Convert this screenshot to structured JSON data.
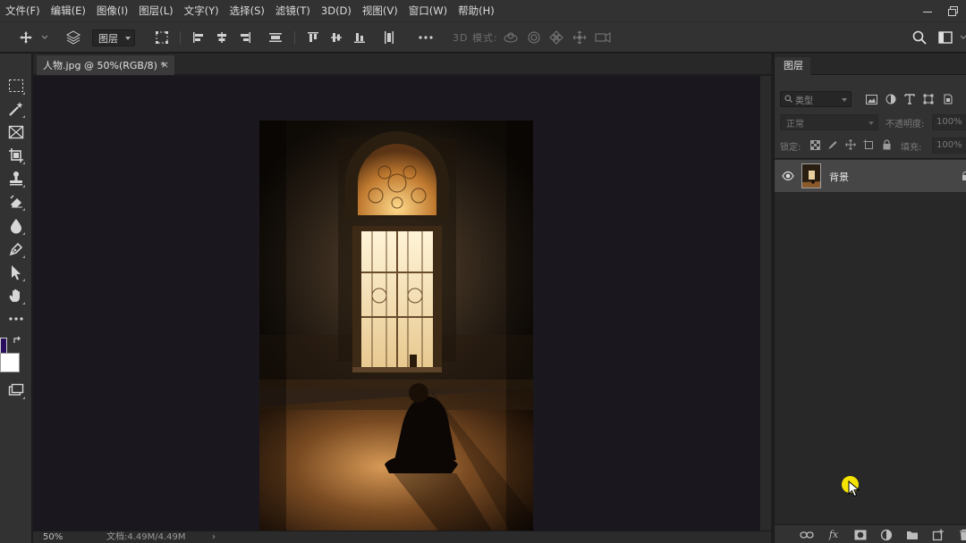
{
  "menu": {
    "items": [
      "文件(F)",
      "编辑(E)",
      "图像(I)",
      "图层(L)",
      "文字(Y)",
      "选择(S)",
      "滤镜(T)",
      "3D(D)",
      "视图(V)",
      "窗口(W)",
      "帮助(H)"
    ]
  },
  "options": {
    "auto_select_target": "图层",
    "mode_3d_label": "3D 模式:"
  },
  "document": {
    "tab_title": "人物.jpg @ 50%(RGB/8) *",
    "close_glyph": "×",
    "zoom": "50%",
    "doc_info": "文档:4.49M/4.49M",
    "status_arrow": "›"
  },
  "layers_panel": {
    "tab_title": "图层",
    "kind_placeholder": "类型",
    "blend_mode": "正常",
    "opacity_label": "不透明度:",
    "opacity_value": "100%",
    "lock_label": "锁定:",
    "fill_label": "填充:",
    "fill_value": "100%",
    "layers": [
      {
        "name": "背景",
        "visible": true,
        "locked": true
      }
    ]
  },
  "colors": {
    "foreground": "#2a0e5e",
    "background": "#ffffff",
    "cursor_highlight": "#f4e300"
  },
  "icons": {
    "toolbar": [
      "move-icon",
      "marquee-icon",
      "magic-wand-icon",
      "frame-icon",
      "crop-icon",
      "stamp-icon",
      "eraser-icon",
      "blur-icon",
      "pen-icon",
      "path-select-icon",
      "hand-icon",
      "more-tools-icon",
      "screen-mode-icon"
    ],
    "panel_bottom": [
      "link-icon",
      "fx-icon",
      "mask-icon",
      "adjustment-icon",
      "group-icon",
      "new-layer-icon",
      "trash-icon"
    ]
  }
}
